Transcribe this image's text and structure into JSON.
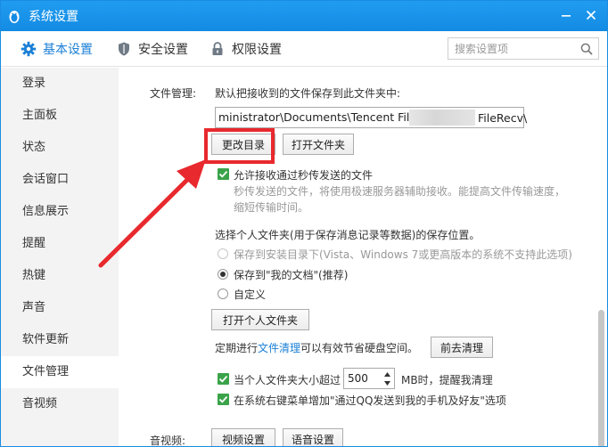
{
  "window": {
    "title": "系统设置"
  },
  "tabs": [
    {
      "label": "基本设置",
      "icon": "gear-icon",
      "active": true
    },
    {
      "label": "安全设置",
      "icon": "shield-icon"
    },
    {
      "label": "权限设置",
      "icon": "lock-icon"
    }
  ],
  "search": {
    "placeholder": "搜索设置项"
  },
  "sidebar": {
    "items": [
      {
        "label": "登录"
      },
      {
        "label": "主面板"
      },
      {
        "label": "状态"
      },
      {
        "label": "会话窗口"
      },
      {
        "label": "信息展示"
      },
      {
        "label": "提醒"
      },
      {
        "label": "热键"
      },
      {
        "label": "声音"
      },
      {
        "label": "软件更新"
      },
      {
        "label": "文件管理",
        "active": true
      },
      {
        "label": "音视频"
      }
    ]
  },
  "file_mgmt": {
    "section_label": "文件管理:",
    "save_desc": "默认把接收到的文件保存到此文件夹中:",
    "path_left": "ministrator\\Documents\\Tencent Files\\",
    "path_right": "FileRecv\\",
    "change_dir_button": "更改目录",
    "open_folder_button": "打开文件夹",
    "allow_flash_label": "允许接收通过秒传发送的文件",
    "allow_flash_hint": "秒传发送的文件，将使用极速服务器辅助接收。能提高文件传输速度，缩短传输时间。",
    "personal_folder_desc": "选择个人文件夹(用于保存消息记录等数据)的保存位置。",
    "radio_install": "保存到安装目录下(Vista、Windows 7或更高版本的系统不支持此选项)",
    "radio_my_docs": "保存到\"我的文档\"(推荐)",
    "radio_custom": "自定义",
    "open_personal_button": "打开个人文件夹",
    "cleanup_prefix": "定期进行",
    "cleanup_link": "文件清理",
    "cleanup_suffix": "可以有效节省硬盘空间。",
    "goto_cleanup_button": "前去清理",
    "size_prefix": "当个人文件夹大小超过",
    "size_value": "500",
    "size_suffix": "MB时，提醒我清理",
    "context_menu_label": "在系统右键菜单增加\"通过QQ发送到我的手机及好友\"选项"
  },
  "av": {
    "section_label": "音视频:",
    "video_button": "视频设置",
    "audio_button": "语音设置"
  },
  "colors": {
    "titlebar": "#148be3",
    "accent": "#1a7fd6",
    "checkbox": "#3aa34a",
    "annotation": "#e8292d"
  }
}
